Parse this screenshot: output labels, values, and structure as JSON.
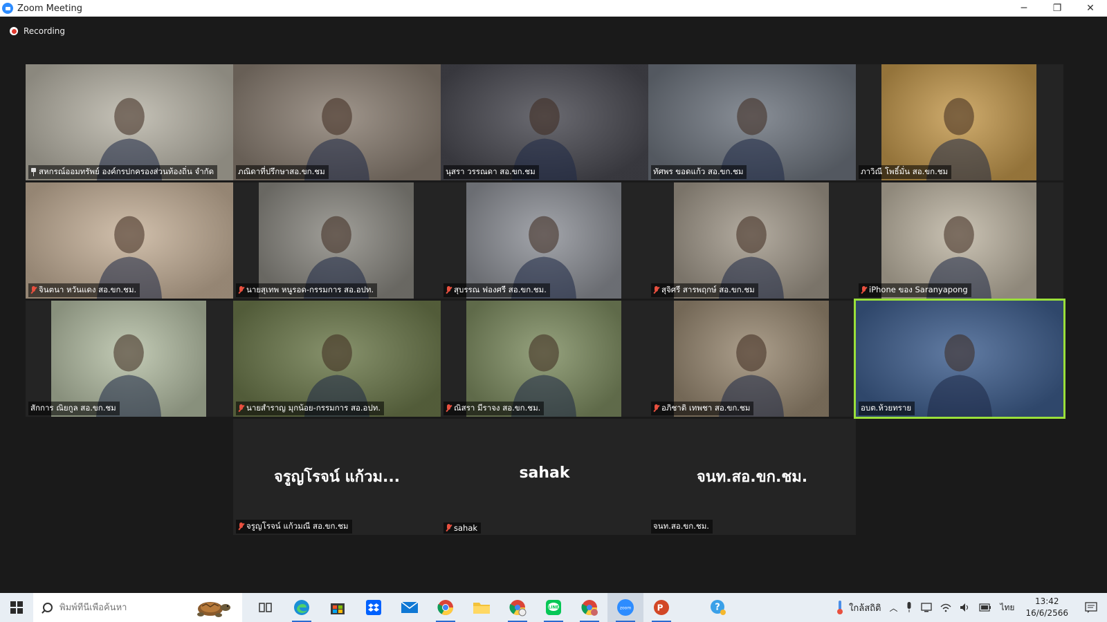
{
  "window": {
    "title": "Zoom Meeting",
    "minimize": "─",
    "restore": "❐",
    "close": "✕"
  },
  "recording": {
    "label": "Recording"
  },
  "participants": [
    {
      "name": "สหกรณ์ออมทรัพย์ องค์กรปกครองส่วนท้องถิ่น จำกัด",
      "icon": "pin-icon",
      "bg": "#b9b5a8"
    },
    {
      "name": "ภณิดาที่ปรึกษาสอ.ขก.ชม",
      "icon": "",
      "bg": "#8b7f73"
    },
    {
      "name": "นุสรา วรรณดา สอ.ขก.ชม",
      "icon": "",
      "bg": "#4a4a52"
    },
    {
      "name": "ทัศพร ขอดแก้ว สอ.ขก.ชม",
      "icon": "",
      "bg": "#6f7680"
    },
    {
      "name": "ภาวิณี โพธิ์มั่น สอ.ขก.ชม",
      "icon": "",
      "bg": "#c59a4e"
    },
    {
      "name": "จินตนา หวันแดง สอ.ขก.ชม.",
      "icon": "mic-muted-icon",
      "bg": "#c7b29a"
    },
    {
      "name": "นายสุเทพ หนูรอด-กรรมการ สอ.อปท.",
      "icon": "mic-muted-icon",
      "bg": "#8c8a83"
    },
    {
      "name": "สุบรรณ ฟองศรี สอ.ขก.ชม.",
      "icon": "mic-muted-icon",
      "bg": "#8f9299"
    },
    {
      "name": "สุจิศรี สารพฤกษ์ สอ.ขก.ชม",
      "icon": "mic-muted-icon",
      "bg": "#a39a8c"
    },
    {
      "name": "iPhone ของ Saranyapong",
      "icon": "mic-muted-icon",
      "bg": "#bfb6a4"
    },
    {
      "name": "สักการ ณิยกูล สอ.ขก.ชม",
      "icon": "",
      "bg": "#b6c0a6"
    },
    {
      "name": "นายสำราญ มุกน้อย-กรรมการ สอ.อปท.",
      "icon": "mic-muted-icon",
      "bg": "#6d7a4c"
    },
    {
      "name": "ณิสรา มีราจง สอ.ขก.ชม.",
      "icon": "mic-muted-icon",
      "bg": "#7f8e62"
    },
    {
      "name": "อภิชาติ เทพชา สอ.ขก.ชม",
      "icon": "mic-muted-icon",
      "bg": "#9a8a73"
    },
    {
      "name": "อบต.ห้วยทราย",
      "icon": "",
      "bg": "#3f5f8f"
    },
    {
      "name": "จรูญโรจน์ แก้วมณี สอ.ขก.ชม",
      "display": "จรูญโรจน์ แก้วม...",
      "icon": "mic-muted-icon",
      "bg": "#242424"
    },
    {
      "name": "sahak",
      "display": "sahak",
      "icon": "mic-muted-icon",
      "bg": "#242424"
    },
    {
      "name": "จนท.สอ.ขก.ชม.",
      "display": "จนท.สอ.ขก.ชม.",
      "icon": "",
      "bg": "#242424"
    }
  ],
  "active_speaker": "อบต.ห้วยทราย",
  "taskbar": {
    "search_placeholder": "พิมพ์ที่นี่เพื่อค้นหา",
    "apps": [
      "task-view-icon",
      "edge-icon",
      "store-icon",
      "dropbox-icon",
      "mail-icon",
      "chrome-icon",
      "file-explorer-icon",
      "chrome-profile-icon",
      "line-icon",
      "chrome-alt-icon",
      "zoom-icon",
      "powerpoint-icon"
    ],
    "weather": "ใกล้สถิติ",
    "language": "ไทย",
    "time": "13:42",
    "date": "16/6/2566"
  },
  "colors": {
    "accent_active": "#9ae03a",
    "muted": "#e8503f",
    "zoom_blue": "#2d8cff"
  }
}
